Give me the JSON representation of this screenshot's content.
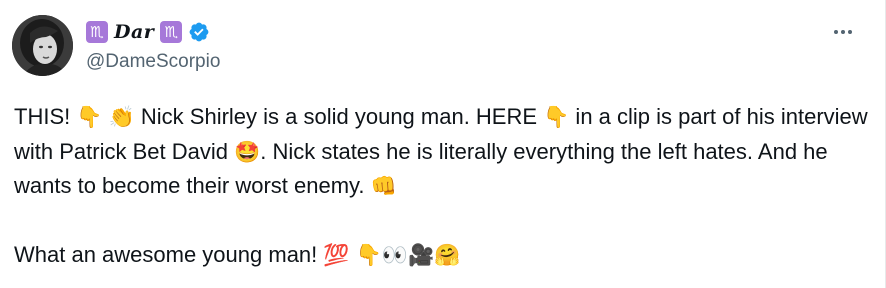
{
  "author": {
    "display_name": "Dar",
    "zodiac_symbol": "♏",
    "handle": "@DameScorpio",
    "verified": true
  },
  "more_icon": "more-horizontal-icon",
  "colors": {
    "zodiac_bg": "#a678d9",
    "verified_blue": "#1d9bf0",
    "text_primary": "#0f1419",
    "text_secondary": "#536471"
  },
  "tweet": {
    "p1": {
      "t1": "THIS! ",
      "e1": "👇",
      "e2": "👏",
      "t2": " Nick Shirley is a solid young man. HERE ",
      "e3": "👇",
      "t3": " in a clip is part of his interview with Patrick Bet David ",
      "e4": "🤩",
      "t4": ". Nick states he is literally everything the left hates. And he wants to become their worst enemy. ",
      "e5": "👊"
    },
    "p2": {
      "t1": "What an awesome young man! ",
      "e1": "💯",
      "e2": "👇",
      "e3": "👀",
      "e4": "🎥",
      "e5": "🤗"
    }
  }
}
